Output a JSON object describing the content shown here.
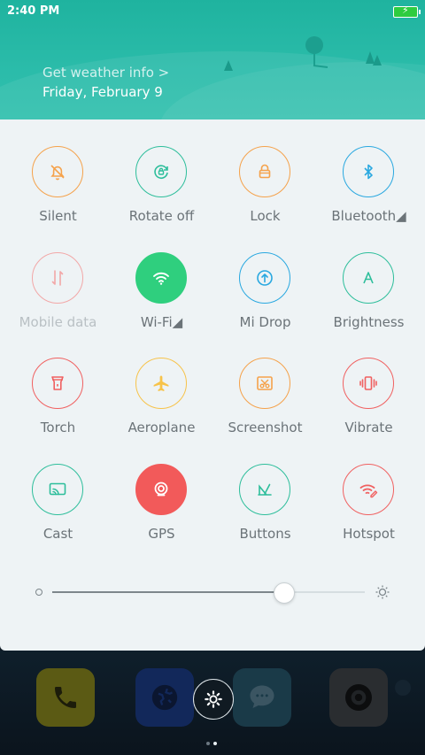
{
  "status_bar": {
    "time": "2:40 PM",
    "battery_icon": "battery-charging-icon"
  },
  "header": {
    "weather_link": "Get weather info >",
    "date": "Friday, February 9"
  },
  "toggles": [
    {
      "label": "Silent",
      "icon": "bell-off-icon",
      "color": "#f5a24b",
      "active": false
    },
    {
      "label": "Rotate off",
      "icon": "rotate-lock-icon",
      "color": "#2dbe9b",
      "active": false
    },
    {
      "label": "Lock",
      "icon": "lock-icon",
      "color": "#f5a24b",
      "active": false
    },
    {
      "label": "Bluetooth◢",
      "icon": "bluetooth-icon",
      "color": "#29a8e0",
      "active": false
    },
    {
      "label": "Mobile data",
      "icon": "mobile-data-icon",
      "color": "#f2a7a7",
      "active": false,
      "disabled": true
    },
    {
      "label": "Wi-Fi◢",
      "icon": "wifi-icon",
      "color": "#2fcf7e",
      "active": true
    },
    {
      "label": "Mi Drop",
      "icon": "mi-drop-icon",
      "color": "#29a8e0",
      "active": false
    },
    {
      "label": "Brightness",
      "icon": "auto-brightness-icon",
      "color": "#2dbe9b",
      "active": false
    },
    {
      "label": "Torch",
      "icon": "torch-icon",
      "color": "#f06060",
      "active": false
    },
    {
      "label": "Aeroplane",
      "icon": "airplane-icon",
      "color": "#f7c34a",
      "active": false
    },
    {
      "label": "Screenshot",
      "icon": "scissors-icon",
      "color": "#f5a24b",
      "active": false
    },
    {
      "label": "Vibrate",
      "icon": "vibrate-icon",
      "color": "#f06060",
      "active": false
    },
    {
      "label": "Cast",
      "icon": "cast-icon",
      "color": "#2dbe9b",
      "active": false
    },
    {
      "label": "GPS",
      "icon": "gps-icon",
      "color": "#f25a5a",
      "active": true
    },
    {
      "label": "Buttons",
      "icon": "buttons-icon",
      "color": "#2dbe9b",
      "active": false
    },
    {
      "label": "Hotspot",
      "icon": "hotspot-icon",
      "color": "#f06060",
      "active": false
    }
  ],
  "brightness": {
    "level": 0.74
  },
  "dock": {
    "apps": [
      {
        "icon": "phone-icon",
        "color": "#e6b800"
      },
      {
        "icon": "browser-icon",
        "color": "#1e73d8"
      },
      {
        "icon": "messaging-icon",
        "color": "#2bbfb0"
      },
      {
        "icon": "camera-icon",
        "color": "#444444"
      }
    ],
    "page_count": 2,
    "active_page": 2
  }
}
